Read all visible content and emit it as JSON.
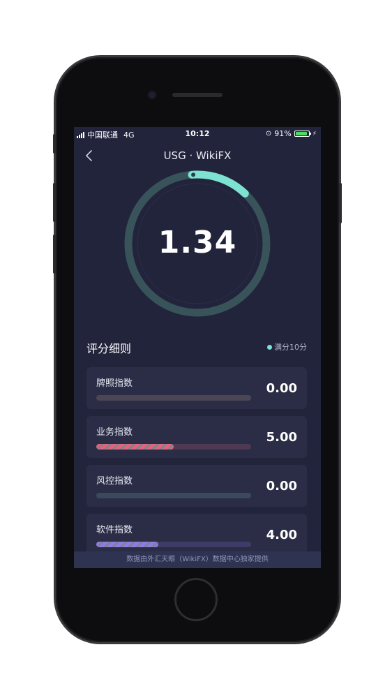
{
  "status_bar": {
    "carrier": "中国联通",
    "network": "4G",
    "time": "10:12",
    "battery_percent": "91%",
    "battery_level": 0.91
  },
  "nav": {
    "title": "USG · WikiFX"
  },
  "score": {
    "value": "1.34",
    "fraction": 0.134,
    "track_color": "#38535a",
    "arc_color": "#7de2d1"
  },
  "breakdown": {
    "title": "评分细则",
    "legend": "满分10分",
    "items": [
      {
        "label": "牌照指数",
        "value": "0.00",
        "fraction": 0.0,
        "track_color": "#4a4654",
        "fill_color": "#8c8a96"
      },
      {
        "label": "业务指数",
        "value": "5.00",
        "fraction": 0.5,
        "track_color": "#4d3a52",
        "fill_color": "#e2637a"
      },
      {
        "label": "风控指数",
        "value": "0.00",
        "fraction": 0.0,
        "track_color": "#3a4a5c",
        "fill_color": "#6b8fb0"
      },
      {
        "label": "软件指数",
        "value": "4.00",
        "fraction": 0.4,
        "track_color": "#3e3b66",
        "fill_color": "#8d7ce6"
      }
    ]
  },
  "footer": {
    "text": "数据由外汇天眼（WikiFX）数据中心独家提供"
  }
}
